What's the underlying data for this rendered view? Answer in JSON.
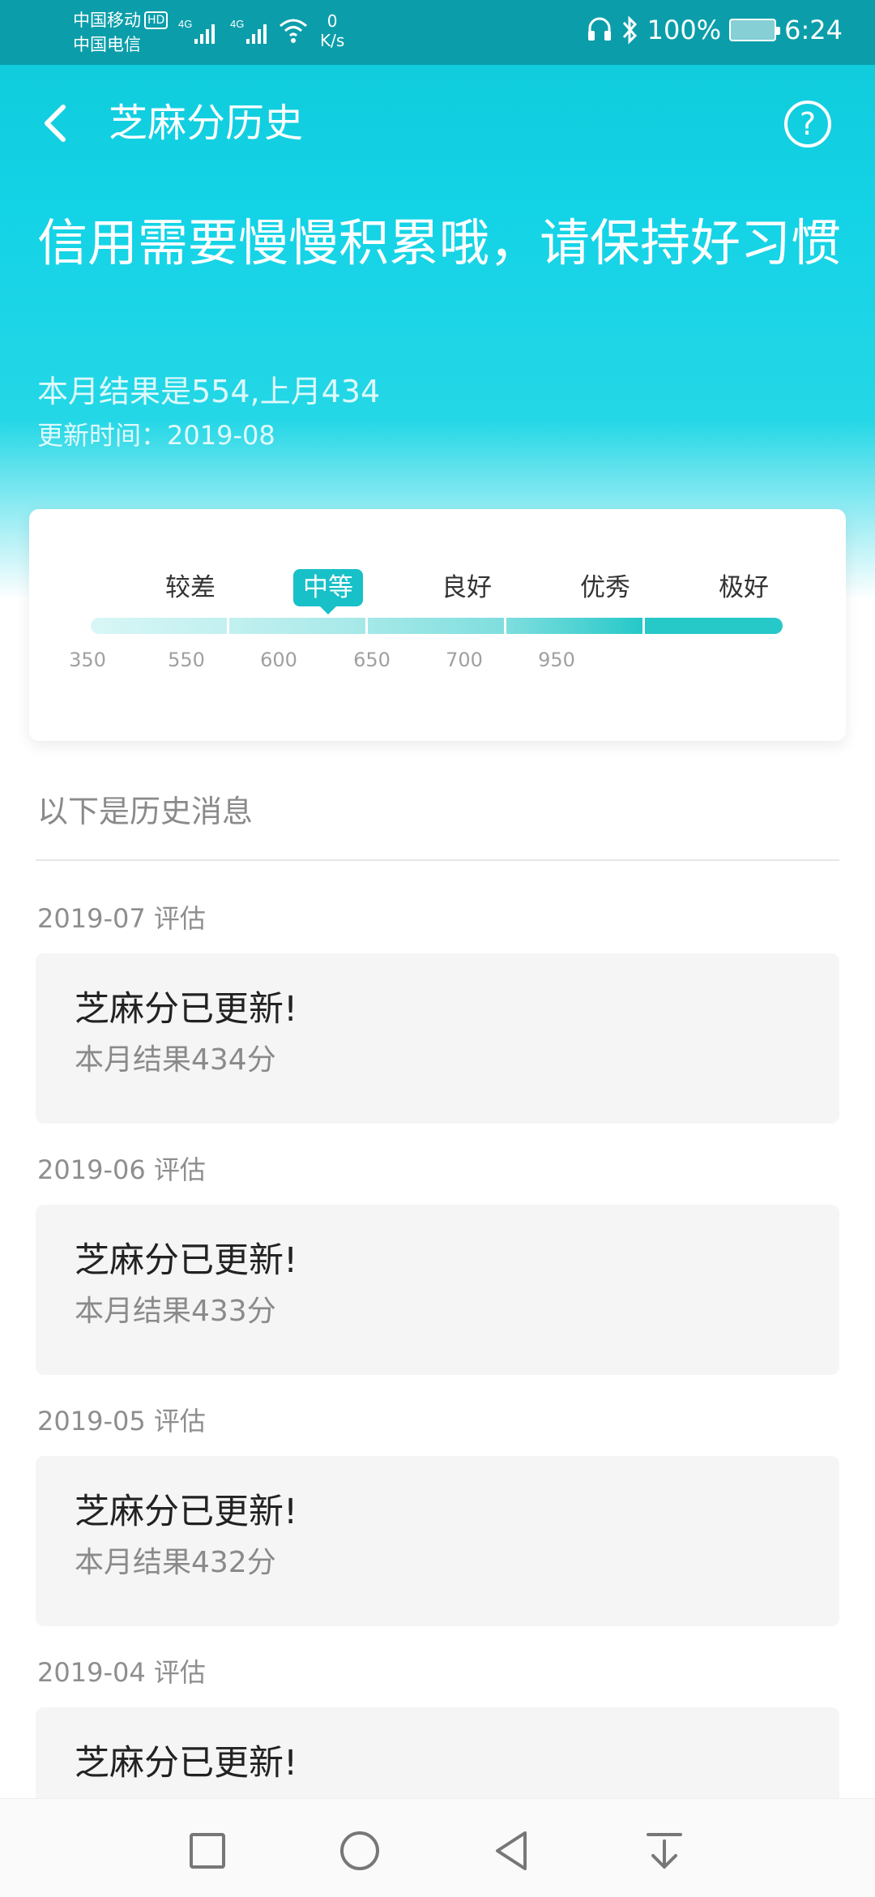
{
  "status_bar": {
    "carrier_1": "中国移动",
    "hd_badge": "HD",
    "carrier_2": "中国电信",
    "net_1": "4G",
    "net_2": "4G",
    "speed_value": "0",
    "speed_unit": "K/s",
    "battery_pct": "100%",
    "time": "6:24"
  },
  "header": {
    "title": "芝麻分历史",
    "help_symbol": "?",
    "headline": "信用需要慢慢积累哦，请保持好习惯",
    "result_text": "本月结果是554,上月434",
    "update_time": "更新时间：2019-08"
  },
  "level_scale": {
    "levels": [
      "较差",
      "中等",
      "良好",
      "优秀",
      "极好"
    ],
    "active_index": 1,
    "ticks": [
      "350",
      "550",
      "600",
      "650",
      "700",
      "950"
    ],
    "segment_colors": [
      "#d9f6f6",
      "#c2f0f0",
      "#a5e8e8",
      "#7fdede",
      "#26c8c8"
    ],
    "accent_color": "#18c0c8"
  },
  "history": {
    "heading": "以下是历史消息",
    "entries": [
      {
        "date": "2019-07 评估",
        "title": "芝麻分已更新!",
        "body": "本月结果434分"
      },
      {
        "date": "2019-06 评估",
        "title": "芝麻分已更新!",
        "body": "本月结果433分"
      },
      {
        "date": "2019-05 评估",
        "title": "芝麻分已更新!",
        "body": "本月结果432分"
      },
      {
        "date": "2019-04 评估",
        "title": "芝麻分已更新!",
        "body": ""
      }
    ]
  },
  "nav": {
    "buttons": [
      "square-icon",
      "circle-icon",
      "back-triangle-icon",
      "pulldown-icon"
    ]
  }
}
